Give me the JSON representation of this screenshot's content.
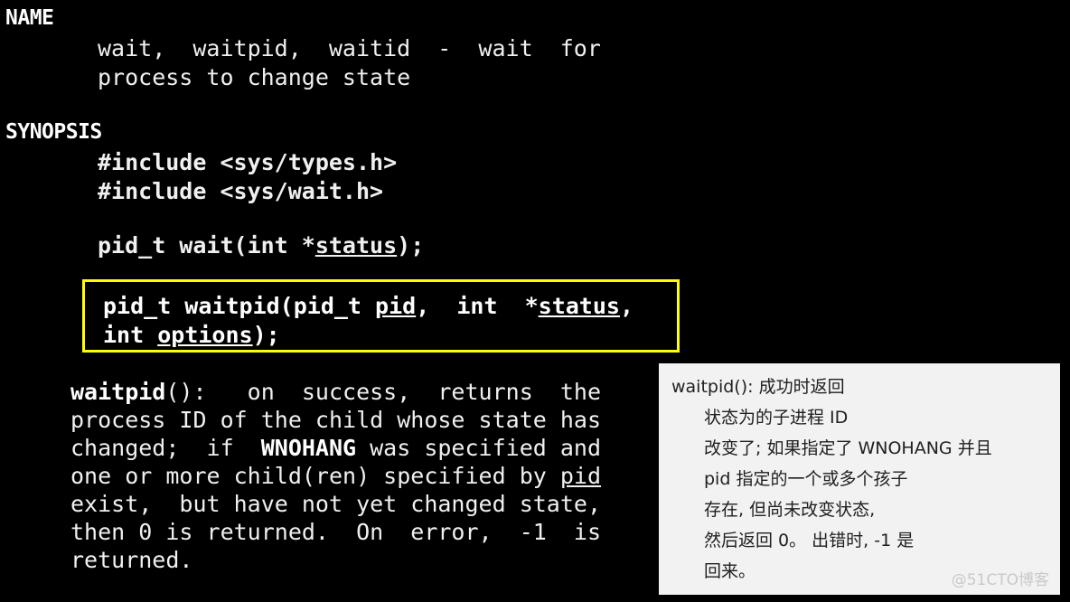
{
  "manpage": {
    "sections": [
      {
        "heading": "NAME",
        "body": [
          "wait,  waitpid,  waitid  -  wait  for",
          "process to change state"
        ]
      },
      {
        "heading": "SYNOPSIS",
        "body": [
          "#include <sys/types.h>",
          "#include <sys/wait.h>"
        ]
      }
    ],
    "name_heading": "NAME",
    "name_body_line1": "wait,  waitpid,  waitid  -  wait  for",
    "name_body_line2": "process to change state",
    "synopsis_heading": "SYNOPSIS",
    "include_line1": "#include <sys/types.h>",
    "include_line2": "#include <sys/wait.h>",
    "wait_prototype_pre": "pid_t wait(int *",
    "wait_prototype_param": "status",
    "wait_prototype_post": ");"
  },
  "highlight_box": {
    "border_color": "#ffff00",
    "line1_a": "pid_t waitpid(pid_t ",
    "line1_param1": "pid",
    "line1_b": ",  int  *",
    "line1_param2": "status",
    "line1_c": ",",
    "line2_a": "int ",
    "line2_param": "options",
    "line2_b": ");"
  },
  "description": {
    "func_bold": "waitpid",
    "seg1": "():   on  success,  returns  the",
    "line2": "process ID of the child whose state has",
    "line3_a": "changed;  if  ",
    "line3_bold": "WNOHANG",
    "line3_b": " was specified and",
    "line4_a": "one or more child(ren) specified by ",
    "line4_param": "pid",
    "line5": "exist,  but have not yet changed state,",
    "line6": "then 0 is returned.  On  error,  -1  is",
    "line7": "returned."
  },
  "translation_panel": {
    "background_color": "#f2f2f2",
    "lines": [
      {
        "text": "waitpid(): 成功时返回",
        "indent": false
      },
      {
        "text": "状态为的子进程 ID",
        "indent": true
      },
      {
        "text": "改变了; 如果指定了 WNOHANG 并且",
        "indent": true
      },
      {
        "text": "pid 指定的一个或多个孩子",
        "indent": true
      },
      {
        "text": "存在, 但尚未改变状态,",
        "indent": true
      },
      {
        "text": "然后返回 0。 出错时, -1 是",
        "indent": true
      },
      {
        "text": "回来。",
        "indent": true
      }
    ],
    "watermark": "@51CTO博客"
  }
}
